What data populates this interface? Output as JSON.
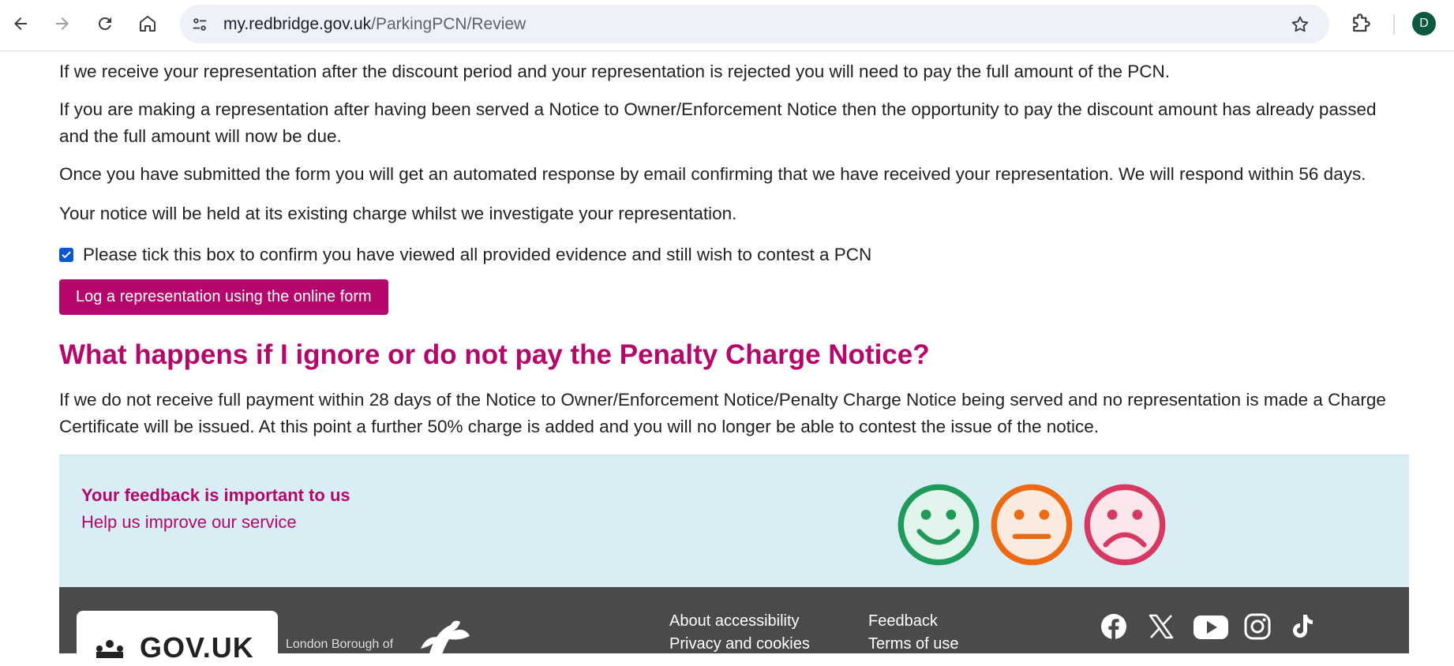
{
  "browser": {
    "url_host": "my.redbridge.gov.uk",
    "url_path": "/ParkingPCN/Review",
    "avatar_letter": "D"
  },
  "content": {
    "paragraphs": [
      "If we receive your representation after the discount period and your representation is rejected you will need to pay the full amount of the PCN.",
      "If you are making a representation after having been served a Notice to Owner/Enforcement Notice then the opportunity to pay the discount amount has already passed and the full amount will now be due.",
      "Once you have submitted the form you will get an automated response by email confirming that we have received your representation. We will respond within 56 days.",
      "Your notice will be held at its existing charge whilst we investigate your representation."
    ],
    "checkbox_label": "Please tick this box to confirm you have viewed all provided evidence and still wish to contest a PCN",
    "checkbox_checked": true,
    "button_label": "Log a representation using the online form",
    "heading": "What happens if I ignore or do not pay the Penalty Charge Notice?",
    "ignore_paragraph": "If we do not receive full payment within 28 days of the Notice to Owner/Enforcement Notice/Penalty Charge Notice being served and no representation is made a Charge Certificate will be issued. At this point a further 50% charge is added and you will no longer be able to contest the issue of the notice."
  },
  "feedback": {
    "title": "Your feedback is important to us",
    "link": "Help us improve our service",
    "faces": [
      "happy-face-icon",
      "neutral-face-icon",
      "sad-face-icon"
    ]
  },
  "footer": {
    "govuk_label": "GOV.UK",
    "borough_label": "London Borough of",
    "links_col1": [
      "About accessibility",
      "Privacy and cookies"
    ],
    "links_col2": [
      "Feedback",
      "Terms of use"
    ],
    "social": [
      "facebook-icon",
      "x-icon",
      "youtube-icon",
      "instagram-icon",
      "tiktok-icon"
    ]
  },
  "colors": {
    "brand": "#b5076b",
    "feedback_bg": "#d9edf5",
    "footer_bg": "#4a4a4a",
    "checkbox": "#0b57d0"
  }
}
